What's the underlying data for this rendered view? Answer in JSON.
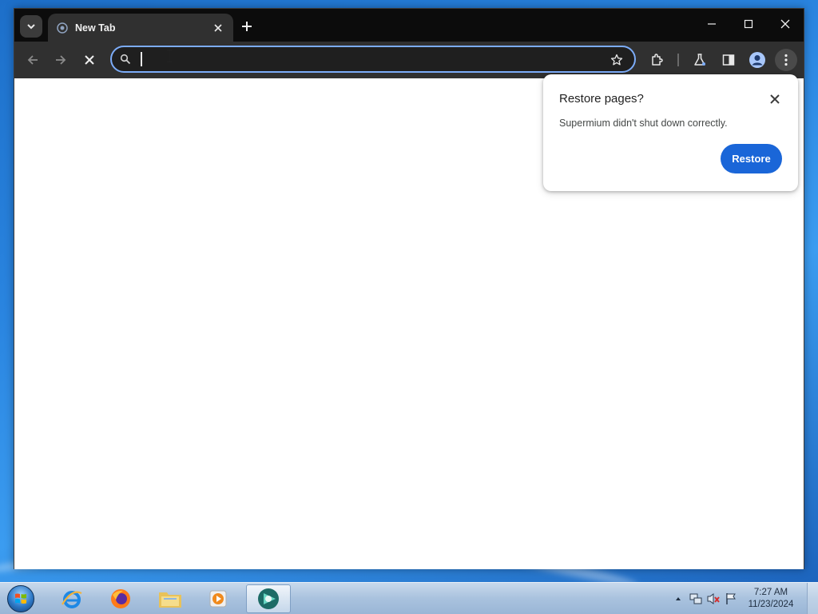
{
  "browser": {
    "tab": {
      "title": "New Tab"
    },
    "omnibox": {
      "value": "",
      "placeholder": ""
    }
  },
  "restore_bubble": {
    "title": "Restore pages?",
    "message": "Supermium didn't shut down correctly.",
    "restore_label": "Restore"
  },
  "taskbar": {
    "pinned": [
      "internet-explorer-icon",
      "firefox-icon",
      "file-explorer-icon",
      "media-player-icon",
      "supermium-icon"
    ],
    "clock": {
      "time": "7:27 AM",
      "date": "11/23/2024"
    }
  },
  "colors": {
    "titlebar": "#0c0c0c",
    "toolbar": "#303030",
    "omnibox_border": "#7cacf8",
    "restore_button": "#1a66d8"
  }
}
